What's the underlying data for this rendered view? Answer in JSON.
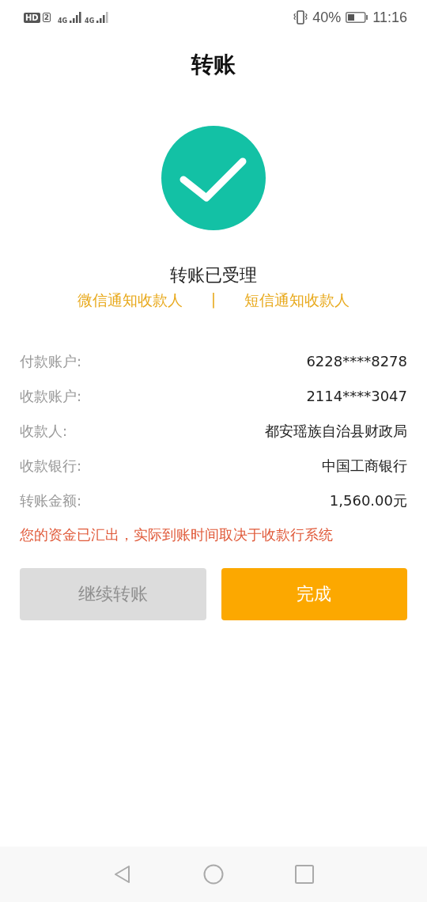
{
  "status_bar": {
    "hd": "HD",
    "sim": "2",
    "network_1": "4G",
    "network_2": "4G",
    "battery": "40%",
    "time": "11:16"
  },
  "title": "转账",
  "result": {
    "text": "转账已受理",
    "links": [
      "微信通知收款人",
      "短信通知收款人"
    ],
    "separator": "|"
  },
  "details": [
    {
      "label": "付款账户:",
      "value": "6228****8278"
    },
    {
      "label": "收款账户:",
      "value": "2114****3047"
    },
    {
      "label": "收款人:",
      "value": "都安瑶族自治县财政局"
    },
    {
      "label": "收款银行:",
      "value": "中国工商银行"
    },
    {
      "label": "转账金额:",
      "value": "1,560.00元"
    }
  ],
  "notice": "您的资金已汇出，实际到账时间取决于收款行系统",
  "buttons": [
    {
      "label": "继续转账",
      "disabled": true
    },
    {
      "label": "完成",
      "disabled": false
    }
  ]
}
